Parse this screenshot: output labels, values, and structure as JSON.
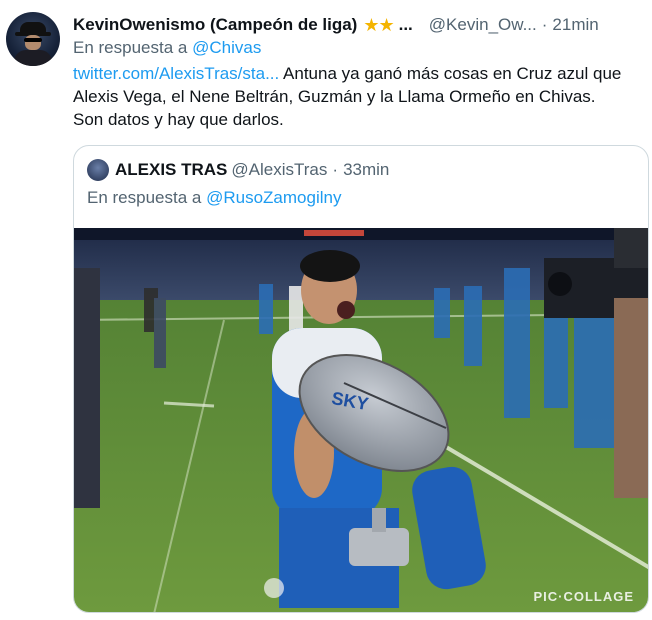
{
  "tweet": {
    "author_name": "KevinOwenismo (Campeón de liga)",
    "stars": "★★",
    "name_overflow": "...",
    "handle": "@Kevin_Ow...",
    "separator": "·",
    "time": "21min",
    "reply_prefix": "En respuesta a",
    "reply_to": "@Chivas",
    "link": "twitter.com/AlexisTras/sta...",
    "text_line1": " Antuna ya ganó más cosas en Cruz azul que Alexis Vega, el Nene Beltrán, Guzmán y la Llama Ormeño en Chivas.",
    "text_line2": "Son datos y hay que darlos."
  },
  "quoted": {
    "author_name": "ALEXIS TRAS",
    "handle": "@AlexisTras",
    "separator": "·",
    "time": "33min",
    "reply_prefix": "En respuesta a",
    "reply_to": "@RusoZamogilny",
    "image_watermark": "PIC·COLLAGE",
    "dish_logo": "SKY"
  }
}
